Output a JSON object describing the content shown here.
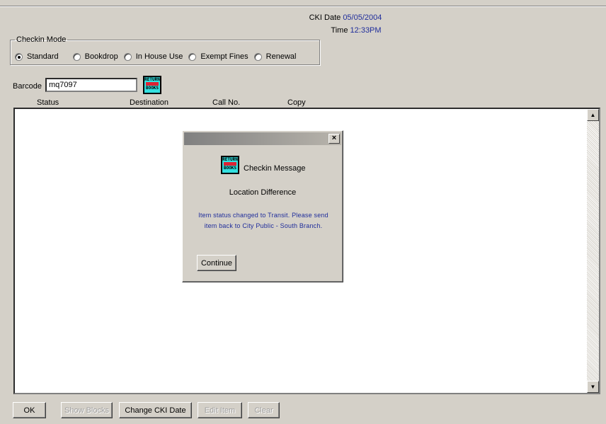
{
  "header": {
    "cki_date_label": "CKI Date",
    "cki_date_value": "05/05/2004",
    "time_label": "Time",
    "time_value": "12:33PM"
  },
  "checkin_mode": {
    "legend": "Checkin Mode",
    "options": [
      {
        "label": "Standard",
        "selected": true
      },
      {
        "label": "Bookdrop",
        "selected": false
      },
      {
        "label": "In House Use",
        "selected": false
      },
      {
        "label": "Exempt Fines",
        "selected": false
      },
      {
        "label": "Renewal",
        "selected": false
      }
    ]
  },
  "barcode": {
    "label": "Barcode",
    "value": "mq7097"
  },
  "return_icon": {
    "icon": "return-books-icon",
    "top_text": "RETURN",
    "bottom_text": "BOOKS"
  },
  "columns": [
    "Status",
    "Destination",
    "Call No.",
    "Copy"
  ],
  "buttons": {
    "ok": "OK",
    "show_blocks": "Show Blocks",
    "change_cki_date": "Change CKI Date",
    "edit_item": "Edit Item",
    "clear": "Clear"
  },
  "dialog": {
    "close_symbol": "×",
    "title": "Checkin Message",
    "subtitle": "Location Difference",
    "message_line1": "Item status changed to Transit. Please send",
    "message_line2": "item back to City Public - South Branch.",
    "continue_label": "Continue"
  },
  "colors": {
    "background": "#d4d0c8",
    "value_text": "#1f2d9b",
    "icon_fill": "#33e0e0",
    "icon_band": "#dd2233"
  }
}
